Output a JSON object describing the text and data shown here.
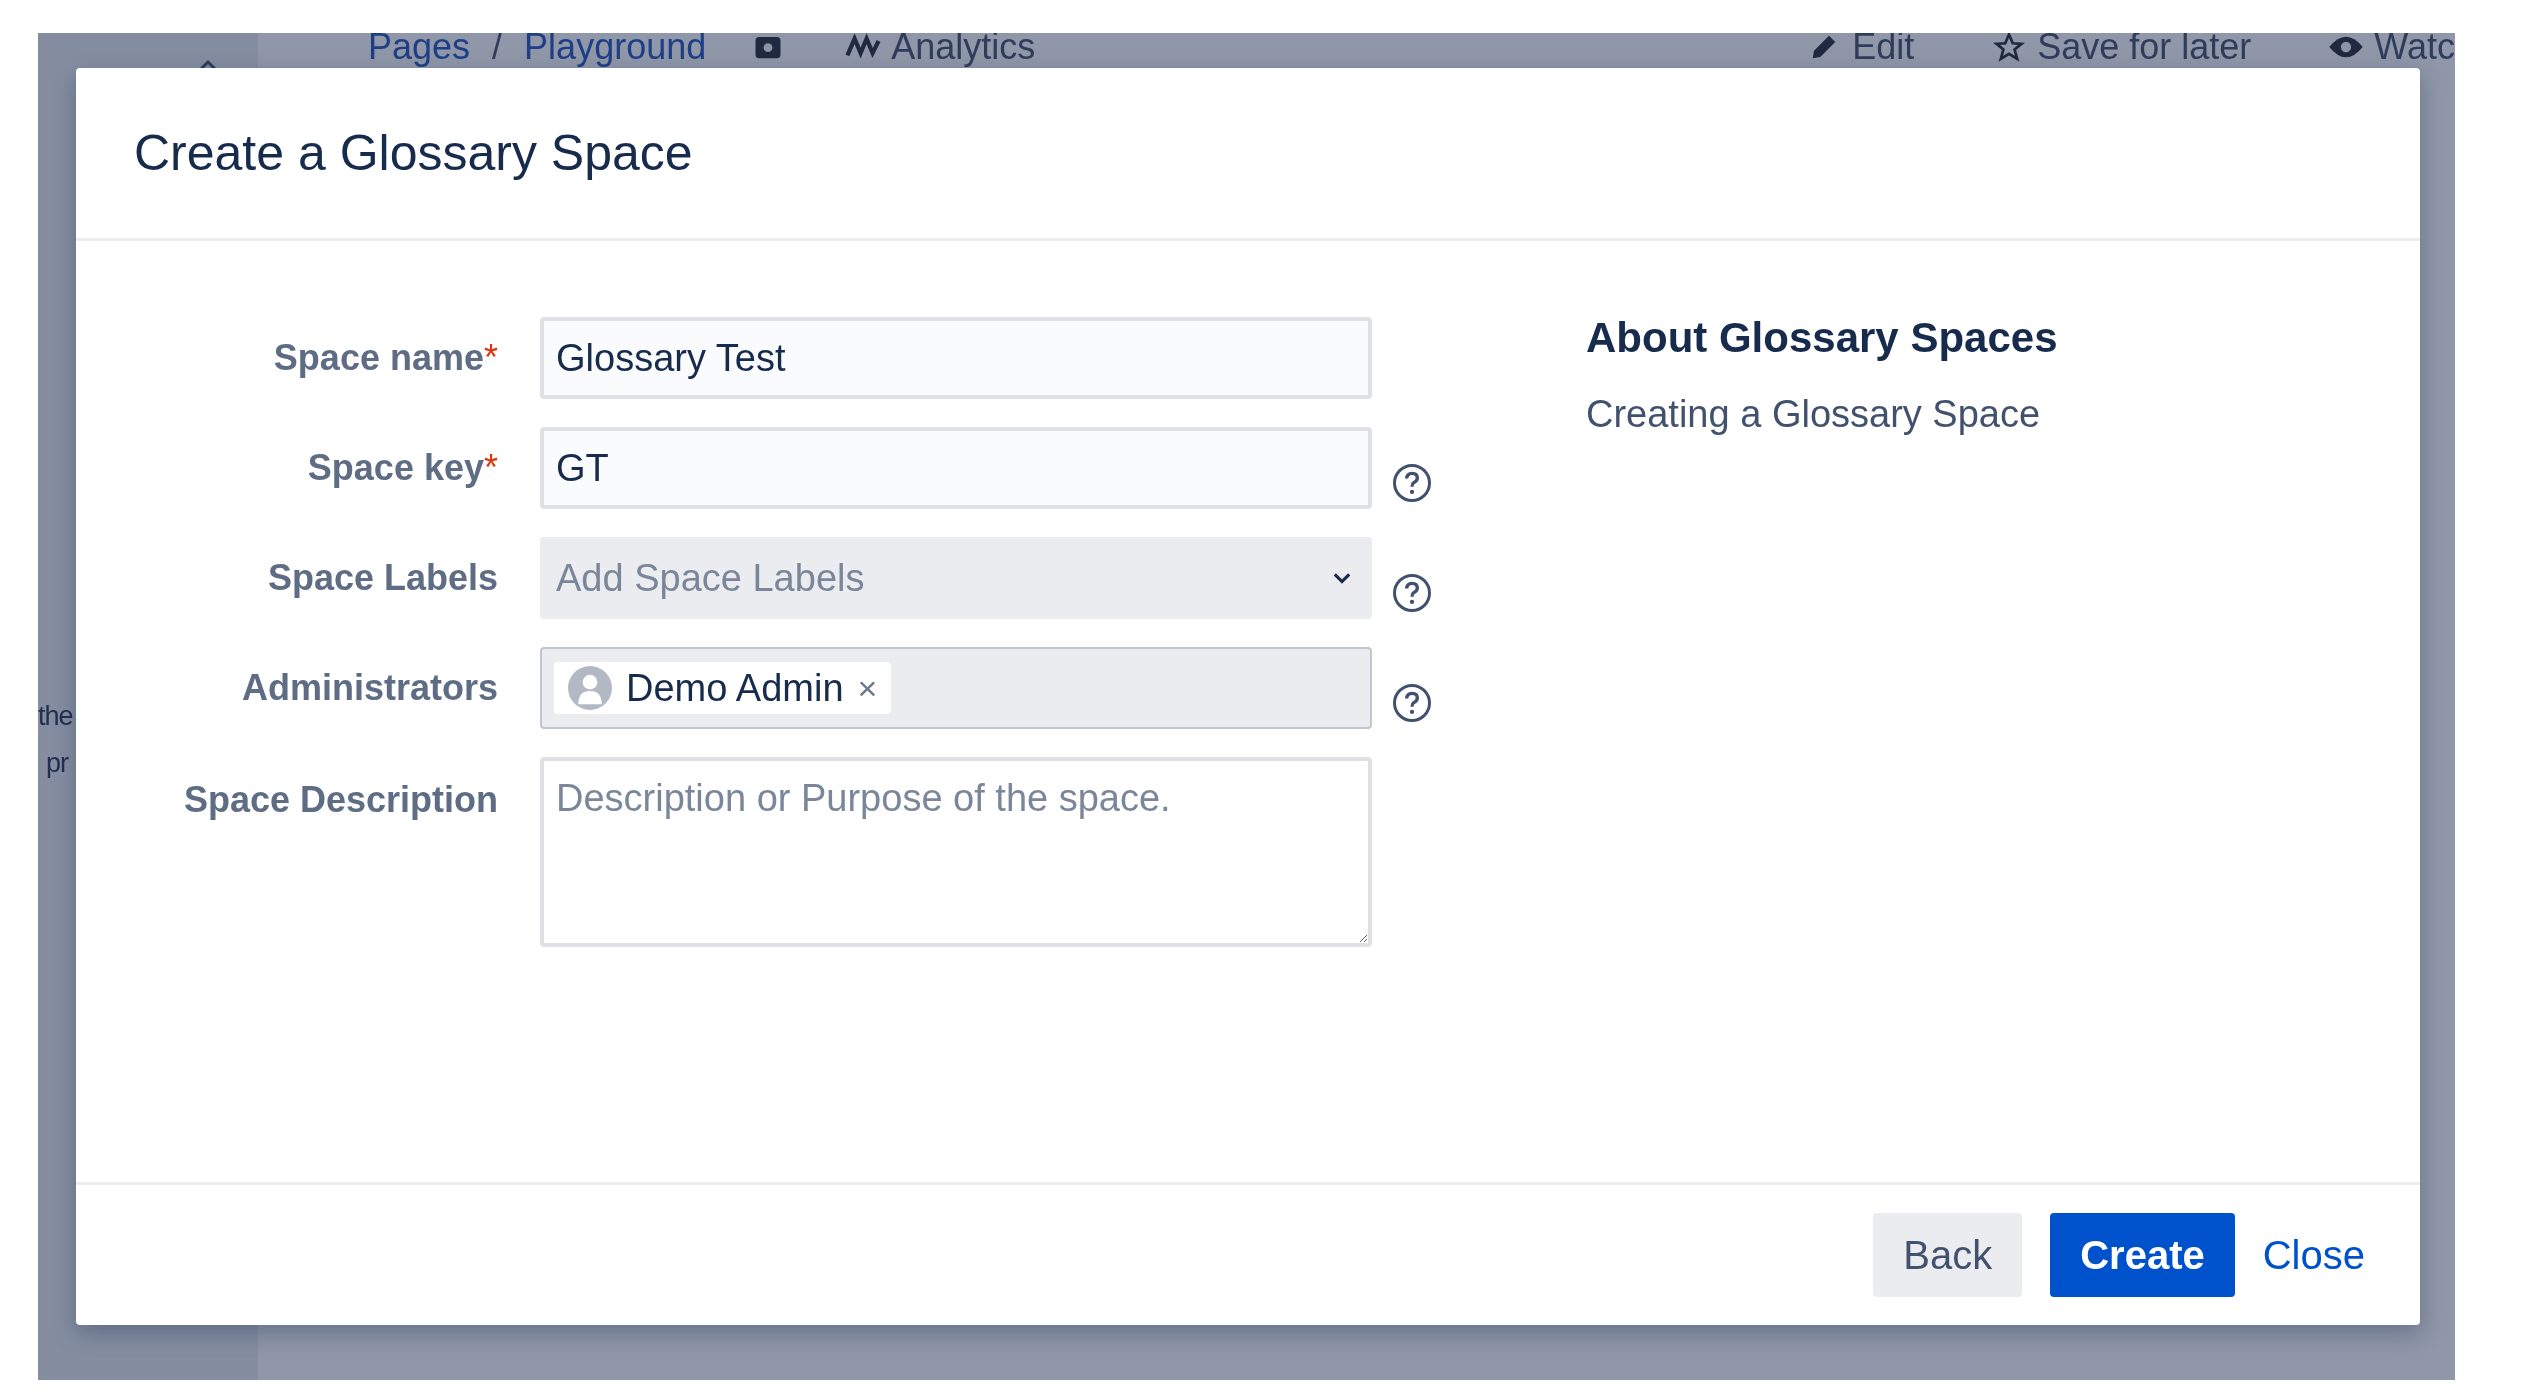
{
  "page": {
    "breadcrumbs": [
      {
        "label": "Pages"
      },
      {
        "label": "Playground"
      }
    ],
    "breadcrumb_separator": "/",
    "nav_actions": [
      {
        "kind": "camera"
      },
      {
        "kind": "analytics",
        "label": "Analytics"
      }
    ],
    "page_actions": [
      {
        "kind": "edit",
        "label": "Edit"
      },
      {
        "kind": "star",
        "label": "Save for later"
      },
      {
        "kind": "eye",
        "label": "Watc"
      }
    ],
    "body_fragments": [
      "the",
      "pr"
    ]
  },
  "dialog": {
    "title": "Create a Glossary Space",
    "fields": [
      {
        "kind": "text",
        "label": "Space name",
        "required_mark": "*",
        "value": "Glossary Test",
        "help": false
      },
      {
        "kind": "text",
        "label": "Space key",
        "required_mark": "*",
        "value": "GT",
        "help": true
      },
      {
        "kind": "select",
        "label": "Space Labels",
        "placeholder": "Add Space Labels",
        "help": true
      },
      {
        "kind": "users",
        "label": "Administrators",
        "chips": [
          {
            "name": "Demo Admin",
            "remove": "×"
          }
        ],
        "help": true
      },
      {
        "kind": "textarea",
        "label": "Space Description",
        "placeholder": "Description or Purpose of the space.",
        "help": false
      }
    ],
    "about": {
      "heading": "About Glossary Spaces",
      "link": "Creating a Glossary Space"
    },
    "buttons": [
      {
        "kind": "secondary",
        "label": "Back"
      },
      {
        "kind": "primary",
        "label": "Create"
      },
      {
        "kind": "link",
        "label": "Close"
      }
    ]
  }
}
